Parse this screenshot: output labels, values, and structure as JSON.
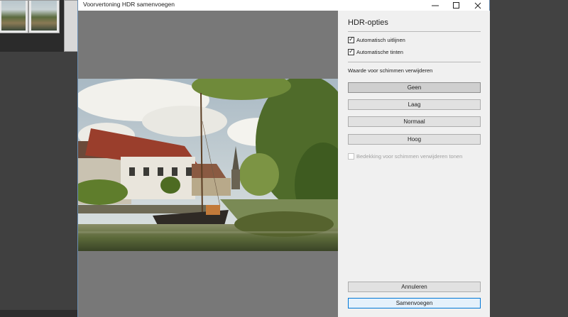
{
  "window": {
    "title": "Voorvertoning HDR samenvoegen"
  },
  "titlebar_icons": [
    "minimize-icon",
    "maximize-icon",
    "close-icon"
  ],
  "options": {
    "heading": "HDR-opties",
    "checkboxes": [
      {
        "label": "Automatisch uitlijnen",
        "checked": true,
        "enabled": true
      },
      {
        "label": "Automatische tinten",
        "checked": true,
        "enabled": true
      }
    ],
    "deghost_label": "Waarde voor schimmen verwijderen",
    "deghost_options": [
      {
        "label": "Geen",
        "selected": true
      },
      {
        "label": "Laag",
        "selected": false
      },
      {
        "label": "Normaal",
        "selected": false
      },
      {
        "label": "Hoog",
        "selected": false
      }
    ],
    "overlay_checkbox": {
      "label": "Bedekking voor schimmen verwijderen tonen",
      "checked": false,
      "enabled": false
    }
  },
  "footer": {
    "cancel_label": "Annuleren",
    "merge_label": "Samenvoegen"
  },
  "colors": {
    "accent": "#0078d7",
    "dialog_bg": "#f0f0f0",
    "preview_bg": "#787878"
  }
}
